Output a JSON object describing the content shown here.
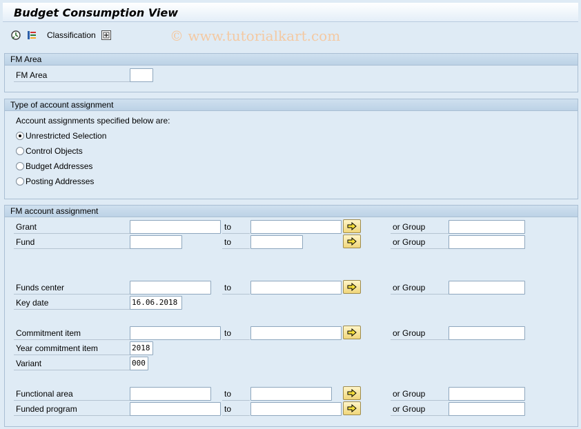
{
  "window": {
    "title": "Budget Consumption View"
  },
  "toolbar": {
    "execute_icon": "execute-clock-icon",
    "variant_icon": "get-variant-icon",
    "classification_label": "Classification",
    "classification_icon": "classification-tree-icon"
  },
  "watermark": "© www.tutorialkart.com",
  "fm_area_group": {
    "title": "FM Area",
    "fm_area_label": "FM Area",
    "fm_area_value": ""
  },
  "assignment_type_group": {
    "title": "Type of account assignment",
    "intro": "Account assignments specified below are:",
    "options": [
      {
        "label": "Unrestricted Selection",
        "selected": true
      },
      {
        "label": "Control Objects",
        "selected": false
      },
      {
        "label": "Budget Addresses",
        "selected": false
      },
      {
        "label": "Posting Addresses",
        "selected": false
      }
    ]
  },
  "fm_assignment_group": {
    "title": "FM account assignment",
    "to_label": "to",
    "group_label": "or Group",
    "rows": {
      "grant": {
        "label": "Grant",
        "from": "",
        "to": "",
        "group": ""
      },
      "fund": {
        "label": "Fund",
        "from": "",
        "to": "",
        "group": ""
      },
      "funds_center": {
        "label": "Funds center",
        "from": "",
        "to": "",
        "group": ""
      },
      "key_date": {
        "label": "Key date",
        "value": "16.06.2018"
      },
      "commitment_item": {
        "label": "Commitment item",
        "from": "",
        "to": "",
        "group": ""
      },
      "year_commitment_item": {
        "label": "Year commitment item",
        "value": "2018"
      },
      "variant": {
        "label": "Variant",
        "value": "000"
      },
      "functional_area": {
        "label": "Functional area",
        "from": "",
        "to": "",
        "group": ""
      },
      "funded_program": {
        "label": "Funded program",
        "from": "",
        "to": "",
        "group": ""
      }
    }
  },
  "colors": {
    "background": "#dfebf5",
    "multiple_selection_button": "#f0d67a",
    "watermark": "#f4c9a2"
  }
}
